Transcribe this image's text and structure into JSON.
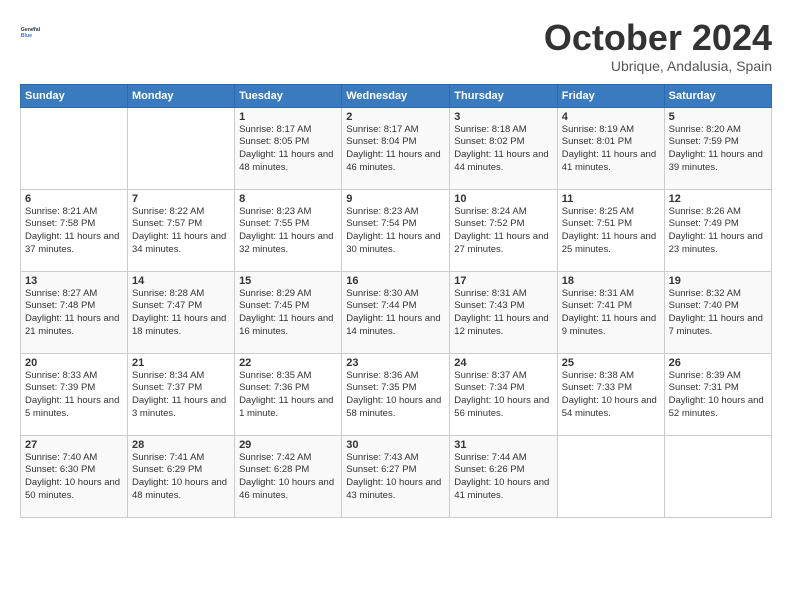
{
  "logo": {
    "line1": "General",
    "line2": "Blue"
  },
  "title": "October 2024",
  "subtitle": "Ubrique, Andalusia, Spain",
  "weekdays": [
    "Sunday",
    "Monday",
    "Tuesday",
    "Wednesday",
    "Thursday",
    "Friday",
    "Saturday"
  ],
  "weeks": [
    [
      {
        "day": "",
        "info": ""
      },
      {
        "day": "",
        "info": ""
      },
      {
        "day": "1",
        "info": "Sunrise: 8:17 AM\nSunset: 8:05 PM\nDaylight: 11 hours and 48 minutes."
      },
      {
        "day": "2",
        "info": "Sunrise: 8:17 AM\nSunset: 8:04 PM\nDaylight: 11 hours and 46 minutes."
      },
      {
        "day": "3",
        "info": "Sunrise: 8:18 AM\nSunset: 8:02 PM\nDaylight: 11 hours and 44 minutes."
      },
      {
        "day": "4",
        "info": "Sunrise: 8:19 AM\nSunset: 8:01 PM\nDaylight: 11 hours and 41 minutes."
      },
      {
        "day": "5",
        "info": "Sunrise: 8:20 AM\nSunset: 7:59 PM\nDaylight: 11 hours and 39 minutes."
      }
    ],
    [
      {
        "day": "6",
        "info": "Sunrise: 8:21 AM\nSunset: 7:58 PM\nDaylight: 11 hours and 37 minutes."
      },
      {
        "day": "7",
        "info": "Sunrise: 8:22 AM\nSunset: 7:57 PM\nDaylight: 11 hours and 34 minutes."
      },
      {
        "day": "8",
        "info": "Sunrise: 8:23 AM\nSunset: 7:55 PM\nDaylight: 11 hours and 32 minutes."
      },
      {
        "day": "9",
        "info": "Sunrise: 8:23 AM\nSunset: 7:54 PM\nDaylight: 11 hours and 30 minutes."
      },
      {
        "day": "10",
        "info": "Sunrise: 8:24 AM\nSunset: 7:52 PM\nDaylight: 11 hours and 27 minutes."
      },
      {
        "day": "11",
        "info": "Sunrise: 8:25 AM\nSunset: 7:51 PM\nDaylight: 11 hours and 25 minutes."
      },
      {
        "day": "12",
        "info": "Sunrise: 8:26 AM\nSunset: 7:49 PM\nDaylight: 11 hours and 23 minutes."
      }
    ],
    [
      {
        "day": "13",
        "info": "Sunrise: 8:27 AM\nSunset: 7:48 PM\nDaylight: 11 hours and 21 minutes."
      },
      {
        "day": "14",
        "info": "Sunrise: 8:28 AM\nSunset: 7:47 PM\nDaylight: 11 hours and 18 minutes."
      },
      {
        "day": "15",
        "info": "Sunrise: 8:29 AM\nSunset: 7:45 PM\nDaylight: 11 hours and 16 minutes."
      },
      {
        "day": "16",
        "info": "Sunrise: 8:30 AM\nSunset: 7:44 PM\nDaylight: 11 hours and 14 minutes."
      },
      {
        "day": "17",
        "info": "Sunrise: 8:31 AM\nSunset: 7:43 PM\nDaylight: 11 hours and 12 minutes."
      },
      {
        "day": "18",
        "info": "Sunrise: 8:31 AM\nSunset: 7:41 PM\nDaylight: 11 hours and 9 minutes."
      },
      {
        "day": "19",
        "info": "Sunrise: 8:32 AM\nSunset: 7:40 PM\nDaylight: 11 hours and 7 minutes."
      }
    ],
    [
      {
        "day": "20",
        "info": "Sunrise: 8:33 AM\nSunset: 7:39 PM\nDaylight: 11 hours and 5 minutes."
      },
      {
        "day": "21",
        "info": "Sunrise: 8:34 AM\nSunset: 7:37 PM\nDaylight: 11 hours and 3 minutes."
      },
      {
        "day": "22",
        "info": "Sunrise: 8:35 AM\nSunset: 7:36 PM\nDaylight: 11 hours and 1 minute."
      },
      {
        "day": "23",
        "info": "Sunrise: 8:36 AM\nSunset: 7:35 PM\nDaylight: 10 hours and 58 minutes."
      },
      {
        "day": "24",
        "info": "Sunrise: 8:37 AM\nSunset: 7:34 PM\nDaylight: 10 hours and 56 minutes."
      },
      {
        "day": "25",
        "info": "Sunrise: 8:38 AM\nSunset: 7:33 PM\nDaylight: 10 hours and 54 minutes."
      },
      {
        "day": "26",
        "info": "Sunrise: 8:39 AM\nSunset: 7:31 PM\nDaylight: 10 hours and 52 minutes."
      }
    ],
    [
      {
        "day": "27",
        "info": "Sunrise: 7:40 AM\nSunset: 6:30 PM\nDaylight: 10 hours and 50 minutes."
      },
      {
        "day": "28",
        "info": "Sunrise: 7:41 AM\nSunset: 6:29 PM\nDaylight: 10 hours and 48 minutes."
      },
      {
        "day": "29",
        "info": "Sunrise: 7:42 AM\nSunset: 6:28 PM\nDaylight: 10 hours and 46 minutes."
      },
      {
        "day": "30",
        "info": "Sunrise: 7:43 AM\nSunset: 6:27 PM\nDaylight: 10 hours and 43 minutes."
      },
      {
        "day": "31",
        "info": "Sunrise: 7:44 AM\nSunset: 6:26 PM\nDaylight: 10 hours and 41 minutes."
      },
      {
        "day": "",
        "info": ""
      },
      {
        "day": "",
        "info": ""
      }
    ]
  ]
}
